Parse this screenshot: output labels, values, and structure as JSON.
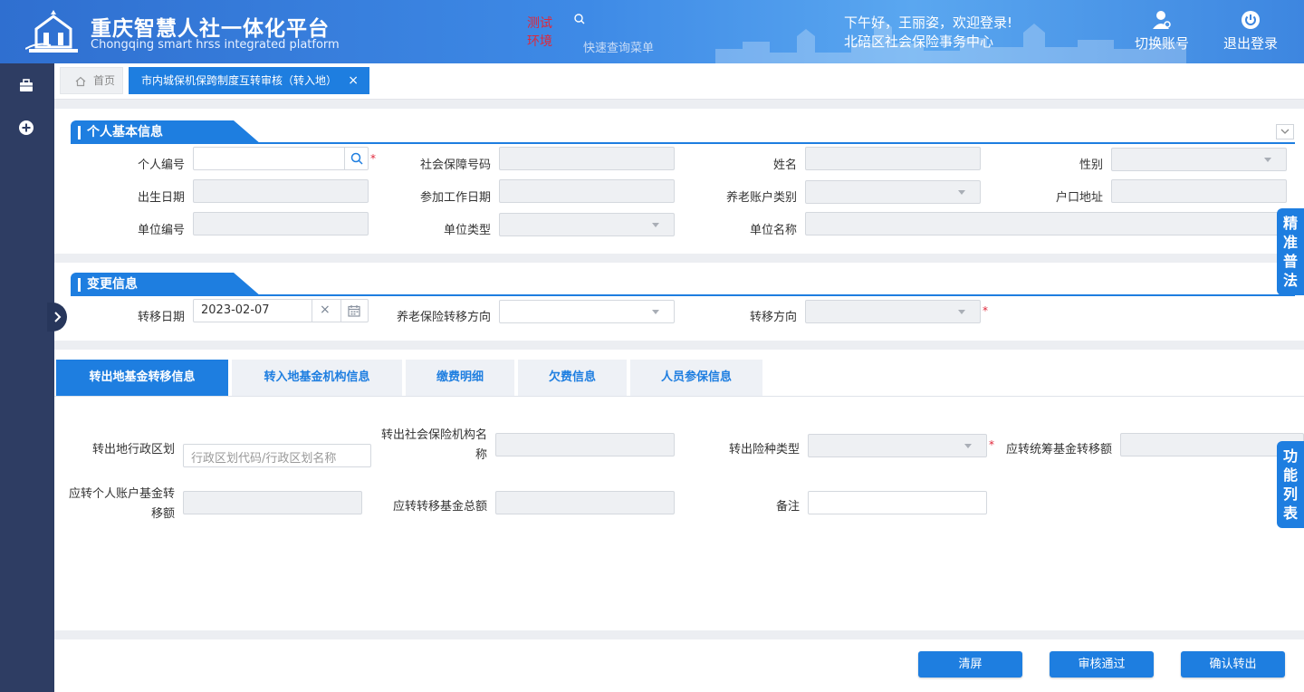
{
  "header": {
    "title": "重庆智慧人社一体化平台",
    "subtitle": "Chongqing smart hrss integrated platform",
    "env_line1": "测试",
    "env_line2": "环境",
    "quick_search_placeholder": "快速查询菜单",
    "greeting": "下午好，王丽姿，欢迎登录!",
    "org": "北碚区社会保险事务中心",
    "switch_account": "切换账号",
    "logout": "退出登录"
  },
  "tabs": {
    "home": "首页",
    "active": "市内城保机保跨制度互转审核（转入地）",
    "close": "×"
  },
  "personal": {
    "title": "个人基本信息",
    "person_id": "个人编号",
    "ss_number": "社会保障号码",
    "name": "姓名",
    "gender": "性别",
    "birth_date": "出生日期",
    "work_start_date": "参加工作日期",
    "pension_account_type": "养老账户类别",
    "household_address": "户口地址",
    "unit_id": "单位编号",
    "unit_type": "单位类型",
    "unit_name": "单位名称"
  },
  "change": {
    "title": "变更信息",
    "transfer_date_label": "转移日期",
    "transfer_date_value": "2023-02-07",
    "clear": "×",
    "pension_direction": "养老保险转移方向",
    "direction": "转移方向"
  },
  "side_floats": {
    "law": [
      "精",
      "准",
      "普",
      "法"
    ],
    "functions": [
      "功",
      "能",
      "列",
      "表"
    ]
  },
  "inner_tabs": [
    "转出地基金转移信息",
    "转入地基金机构信息",
    "缴费明细",
    "欠费信息",
    "人员参保信息"
  ],
  "transfer_out": {
    "region_label": "转出地行政区划",
    "region_placeholder": "行政区划代码/行政区划名称",
    "agency_label_1": "转出社会保险机构名",
    "agency_label_2": "称",
    "insurance_type": "转出险种类型",
    "pooled_fund": "应转统筹基金转移额",
    "personal_fund_1": "应转个人账户基金转",
    "personal_fund_2": "移额",
    "total_fund": "应转转移基金总额",
    "remark": "备注"
  },
  "buttons": {
    "clear_screen": "清屏",
    "approve": "审核通过",
    "confirm_out": "确认转出"
  },
  "colors": {
    "accent": "#1e7ee0",
    "sidebar": "#2e3d63",
    "required": "#e0273a"
  }
}
